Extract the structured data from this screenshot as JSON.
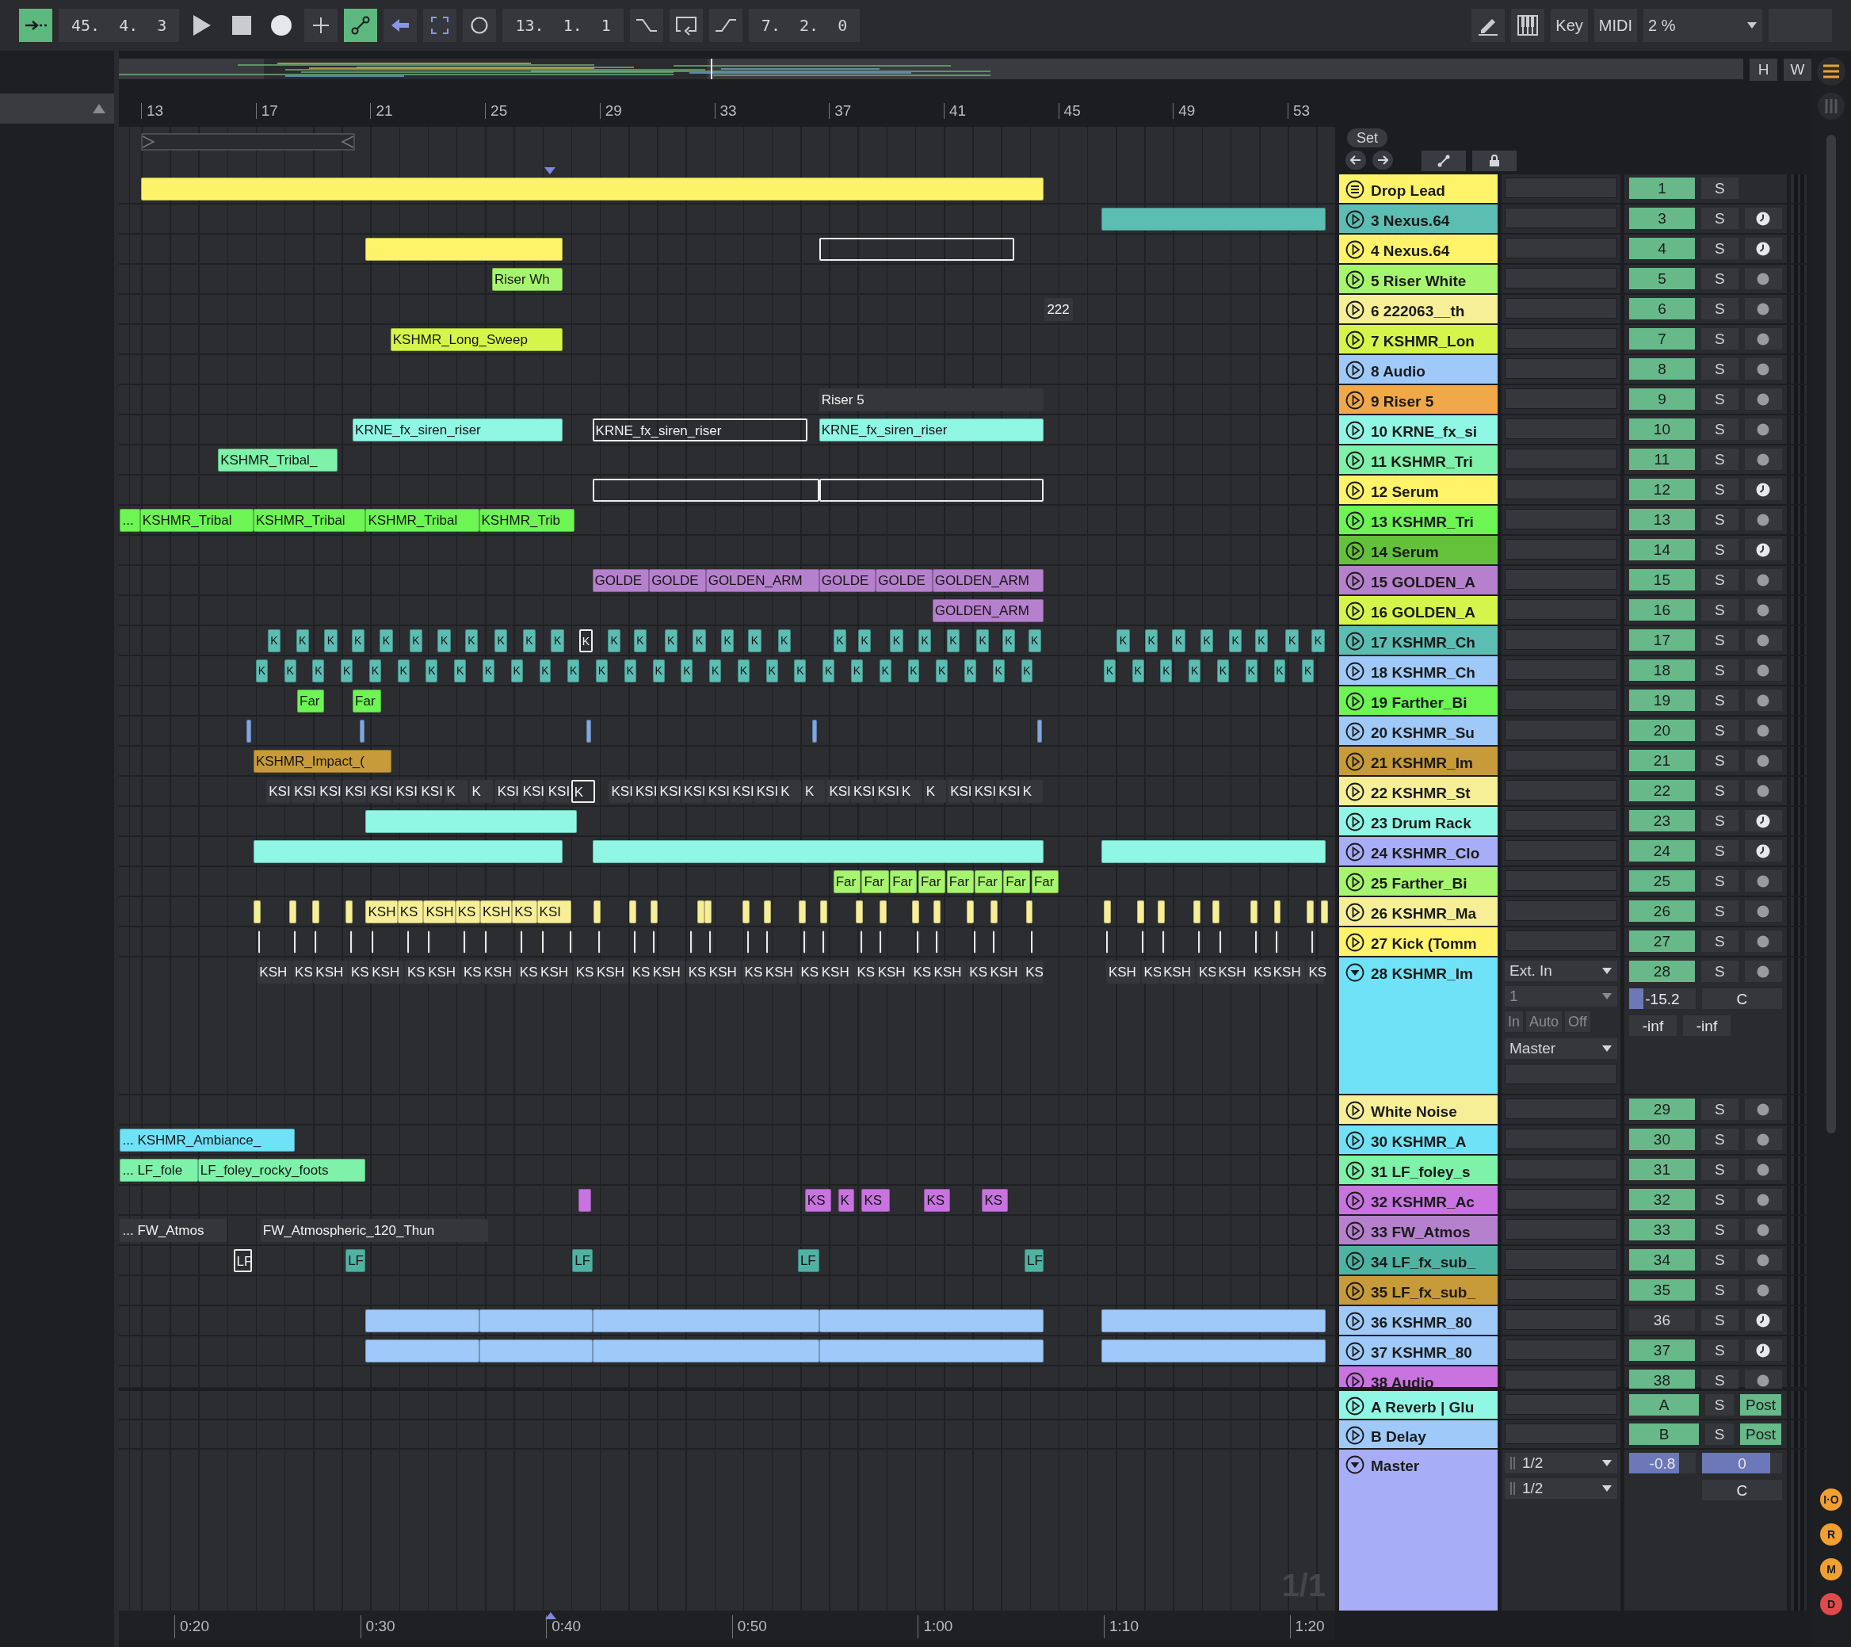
{
  "toolbar": {
    "left": [
      {
        "kind": "follow",
        "on": true
      },
      {
        "kind": "display",
        "text": "45.  4.  3"
      },
      {
        "kind": "play",
        "on": false
      },
      {
        "kind": "stop",
        "on": false
      },
      {
        "kind": "record",
        "on": false
      },
      {
        "kind": "add",
        "on": false
      },
      {
        "kind": "automation",
        "on": true
      },
      {
        "kind": "back",
        "on": false
      },
      {
        "kind": "punch",
        "on": false
      },
      {
        "kind": "loop-record",
        "on": false
      },
      {
        "kind": "display",
        "text": "13.  1.  1"
      },
      {
        "kind": "punch-in",
        "on": false
      },
      {
        "kind": "loop",
        "on": false
      },
      {
        "kind": "punch-out",
        "on": false
      },
      {
        "kind": "display",
        "text": "7.  2.  0"
      }
    ],
    "right": [
      {
        "kind": "draw"
      },
      {
        "kind": "keyboard"
      },
      {
        "kind": "text",
        "text": "Key"
      },
      {
        "kind": "text",
        "text": "MIDI"
      },
      {
        "kind": "cpu",
        "text": "2 %"
      },
      {
        "kind": "blank"
      }
    ]
  },
  "overview": {
    "buttons": [
      "H",
      "W"
    ]
  },
  "ruler": {
    "bars": [
      "13",
      "17",
      "21",
      "25",
      "29",
      "33",
      "37",
      "41",
      "45",
      "49",
      "53"
    ],
    "set_label": "Set"
  },
  "tracks": [
    {
      "kind": "group",
      "name": "Drop Lead",
      "color": "#fff36a",
      "expanded": false,
      "number": "1",
      "number_on": true,
      "solo": "S",
      "clips": [
        {
          "kind": "clip"
        }
      ]
    },
    {
      "kind": "track",
      "name": "3 Nexus.64",
      "color": "#5cbdb3",
      "expanded": false,
      "number": "3",
      "number_on": true,
      "solo": "S",
      "arm": {
        "kind": "clock"
      },
      "clips": [
        {
          "kind": "clip"
        }
      ]
    },
    {
      "kind": "track",
      "name": "4 Nexus.64",
      "color": "#fff36a",
      "expanded": false,
      "number": "4",
      "number_on": true,
      "solo": "S",
      "arm": {
        "kind": "clock"
      },
      "clips": [
        {
          "kind": "clip"
        },
        {
          "kind": "outline"
        }
      ]
    },
    {
      "kind": "track",
      "name": "5 Riser White",
      "color": "#a6f56e",
      "expanded": false,
      "number": "5",
      "number_on": true,
      "solo": "S",
      "arm": {
        "kind": "dot"
      },
      "clips": [
        {
          "kind": "clip",
          "label": "Riser Wh"
        }
      ]
    },
    {
      "kind": "track",
      "name": "6 222063__th",
      "color": "#f6ef98",
      "expanded": false,
      "number": "6",
      "number_on": true,
      "solo": "S",
      "arm": {
        "kind": "dot"
      },
      "clips": [
        {
          "kind": "muted",
          "label": "222"
        }
      ]
    },
    {
      "kind": "track",
      "name": "7 KSHMR_Lon",
      "color": "#d6f54a",
      "expanded": false,
      "number": "7",
      "number_on": true,
      "solo": "S",
      "arm": {
        "kind": "dot"
      },
      "clips": [
        {
          "kind": "clip",
          "label": "KSHMR_Long_Sweep"
        }
      ]
    },
    {
      "kind": "track",
      "name": "8 Audio",
      "color": "#9ec9f8",
      "expanded": false,
      "number": "8",
      "number_on": true,
      "solo": "S",
      "arm": {
        "kind": "dot"
      }
    },
    {
      "kind": "track",
      "name": "9 Riser 5",
      "color": "#f0a848",
      "expanded": false,
      "number": "9",
      "number_on": true,
      "solo": "S",
      "arm": {
        "kind": "dot"
      },
      "clips": [
        {
          "kind": "muted",
          "label": "Riser 5"
        }
      ]
    },
    {
      "kind": "track",
      "name": "10 KRNE_fx_si",
      "color": "#8ff7e4",
      "expanded": false,
      "number": "10",
      "number_on": true,
      "solo": "S",
      "arm": {
        "kind": "dot"
      },
      "clips": [
        {
          "kind": "clip",
          "label": "KRNE_fx_siren_riser"
        },
        {
          "kind": "outline",
          "label": "KRNE_fx_siren_riser"
        },
        {
          "kind": "clip",
          "label": "KRNE_fx_siren_riser"
        }
      ]
    },
    {
      "kind": "track",
      "name": "11 KSHMR_Tri",
      "color": "#7df2a8",
      "expanded": false,
      "number": "11",
      "number_on": true,
      "solo": "S",
      "arm": {
        "kind": "dot"
      },
      "clips": [
        {
          "kind": "clip",
          "label": "KSHMR_Tribal_"
        }
      ]
    },
    {
      "kind": "track",
      "name": "12 Serum",
      "color": "#fff36a",
      "expanded": false,
      "number": "12",
      "number_on": true,
      "solo": "S",
      "arm": {
        "kind": "clock"
      },
      "clips": [
        {
          "kind": "outline"
        },
        {
          "kind": "outline"
        }
      ]
    },
    {
      "kind": "track",
      "name": "13 KSHMR_Tri",
      "color": "#6cf553",
      "expanded": false,
      "number": "13",
      "number_on": true,
      "solo": "S",
      "arm": {
        "kind": "dot"
      },
      "clips": [
        {
          "kind": "clip",
          "label": "..."
        },
        {
          "kind": "clip",
          "label": "KSHMR_Tribal"
        },
        {
          "kind": "clip",
          "label": "KSHMR_Tribal"
        },
        {
          "kind": "clip",
          "label": "KSHMR_Tribal"
        },
        {
          "kind": "clip",
          "label": "KSHMR_Trib"
        }
      ]
    },
    {
      "kind": "track",
      "name": "14 Serum",
      "color": "#63c23a",
      "expanded": false,
      "number": "14",
      "number_on": true,
      "solo": "S",
      "arm": {
        "kind": "clock"
      }
    },
    {
      "kind": "track",
      "name": "15 GOLDEN_A",
      "color": "#b681cc",
      "expanded": false,
      "number": "15",
      "number_on": true,
      "solo": "S",
      "arm": {
        "kind": "dot"
      },
      "clips": [
        {
          "kind": "clip",
          "label": "GOLDE"
        },
        {
          "kind": "clip",
          "label": "GOLDE"
        },
        {
          "kind": "clip",
          "label": "GOLDEN_ARM"
        },
        {
          "kind": "clip",
          "label": "GOLDE"
        },
        {
          "kind": "clip",
          "label": "GOLDE"
        },
        {
          "kind": "clip",
          "label": "GOLDEN_ARM"
        }
      ]
    },
    {
      "kind": "track",
      "name": "16 GOLDEN_A",
      "color": "#d6f54a",
      "expanded": false,
      "number": "16",
      "number_on": true,
      "solo": "S",
      "arm": {
        "kind": "dot"
      },
      "clips": [
        {
          "kind": "clip",
          "label": "GOLDEN_ARM",
          "color": "#b681cc"
        }
      ]
    },
    {
      "kind": "track",
      "name": "17 KSHMR_Ch",
      "color": "#5cbdb3",
      "expanded": false,
      "number": "17",
      "number_on": true,
      "solo": "S",
      "arm": {
        "kind": "dot"
      },
      "clips": [
        {
          "kind": "clip",
          "label": "K"
        },
        {
          "kind": "clip",
          "label": "K"
        },
        {
          "kind": "clip",
          "label": "K"
        },
        {
          "kind": "clip",
          "label": "K"
        },
        {
          "kind": "clip",
          "label": "K"
        },
        {
          "kind": "clip",
          "label": "K"
        },
        {
          "kind": "clip",
          "label": "K"
        },
        {
          "kind": "clip",
          "label": "K"
        },
        {
          "kind": "clip",
          "label": "K"
        },
        {
          "kind": "clip",
          "label": "K"
        },
        {
          "kind": "clip",
          "label": "K"
        },
        {
          "kind": "outline",
          "label": "K"
        },
        {
          "kind": "clip",
          "label": "K"
        },
        {
          "kind": "clip",
          "label": "K"
        },
        {
          "kind": "clip",
          "label": "K"
        },
        {
          "kind": "clip",
          "label": "K"
        },
        {
          "kind": "clip",
          "label": "K"
        },
        {
          "kind": "clip",
          "label": "K"
        },
        {
          "kind": "clip",
          "label": "K"
        },
        {
          "kind": "clip",
          "label": "K"
        },
        {
          "kind": "clip",
          "label": "K"
        },
        {
          "kind": "clip",
          "label": "K"
        },
        {
          "kind": "clip",
          "label": "K"
        },
        {
          "kind": "clip",
          "label": "K"
        },
        {
          "kind": "clip",
          "label": "K"
        },
        {
          "kind": "clip",
          "label": "K"
        },
        {
          "kind": "clip",
          "label": "K"
        },
        {
          "kind": "clip",
          "label": "K"
        },
        {
          "kind": "clip",
          "label": "K"
        },
        {
          "kind": "clip",
          "label": "K"
        },
        {
          "kind": "clip",
          "label": "K"
        },
        {
          "kind": "clip",
          "label": "K"
        },
        {
          "kind": "clip",
          "label": "K"
        },
        {
          "kind": "clip",
          "label": "K"
        },
        {
          "kind": "clip",
          "label": "K"
        }
      ]
    },
    {
      "kind": "track",
      "name": "18 KSHMR_Ch",
      "color": "#9ec9f8",
      "expanded": false,
      "number": "18",
      "number_on": true,
      "solo": "S",
      "arm": {
        "kind": "dot"
      },
      "clips": [
        {
          "kind": "clip",
          "label": "K",
          "color": "#5cbdb3"
        },
        {
          "kind": "clip",
          "label": "K",
          "color": "#5cbdb3"
        },
        {
          "kind": "clip",
          "label": "K",
          "color": "#5cbdb3"
        },
        {
          "kind": "clip",
          "label": "K",
          "color": "#5cbdb3"
        },
        {
          "kind": "clip",
          "label": "K",
          "color": "#5cbdb3"
        },
        {
          "kind": "clip",
          "label": "K",
          "color": "#5cbdb3"
        },
        {
          "kind": "clip",
          "label": "K",
          "color": "#5cbdb3"
        },
        {
          "kind": "clip",
          "label": "K",
          "color": "#5cbdb3"
        },
        {
          "kind": "clip",
          "label": "K",
          "color": "#5cbdb3"
        },
        {
          "kind": "clip",
          "label": "K",
          "color": "#5cbdb3"
        },
        {
          "kind": "clip",
          "label": "K",
          "color": "#5cbdb3"
        },
        {
          "kind": "clip",
          "label": "K",
          "color": "#5cbdb3"
        },
        {
          "kind": "clip",
          "label": "K",
          "color": "#5cbdb3"
        },
        {
          "kind": "clip",
          "label": "K",
          "color": "#5cbdb3"
        },
        {
          "kind": "clip",
          "label": "K",
          "color": "#5cbdb3"
        },
        {
          "kind": "clip",
          "label": "K",
          "color": "#5cbdb3"
        },
        {
          "kind": "clip",
          "label": "K",
          "color": "#5cbdb3"
        },
        {
          "kind": "clip",
          "label": "K",
          "color": "#5cbdb3"
        },
        {
          "kind": "clip",
          "label": "K",
          "color": "#5cbdb3"
        },
        {
          "kind": "clip",
          "label": "K",
          "color": "#5cbdb3"
        },
        {
          "kind": "clip",
          "label": "K",
          "color": "#5cbdb3"
        },
        {
          "kind": "clip",
          "label": "K",
          "color": "#5cbdb3"
        },
        {
          "kind": "clip",
          "label": "K",
          "color": "#5cbdb3"
        },
        {
          "kind": "clip",
          "label": "K",
          "color": "#5cbdb3"
        },
        {
          "kind": "clip",
          "label": "K",
          "color": "#5cbdb3"
        },
        {
          "kind": "clip",
          "label": "K",
          "color": "#5cbdb3"
        },
        {
          "kind": "clip",
          "label": "K",
          "color": "#5cbdb3"
        },
        {
          "kind": "clip",
          "label": "K",
          "color": "#5cbdb3"
        },
        {
          "kind": "clip",
          "label": "K",
          "color": "#5cbdb3"
        },
        {
          "kind": "clip",
          "label": "K",
          "color": "#5cbdb3"
        },
        {
          "kind": "clip",
          "label": "K",
          "color": "#5cbdb3"
        },
        {
          "kind": "clip",
          "label": "K",
          "color": "#5cbdb3"
        },
        {
          "kind": "clip",
          "label": "K",
          "color": "#5cbdb3"
        },
        {
          "kind": "clip",
          "label": "K",
          "color": "#5cbdb3"
        },
        {
          "kind": "clip",
          "label": "K",
          "color": "#5cbdb3"
        },
        {
          "kind": "clip",
          "label": "K",
          "color": "#5cbdb3"
        }
      ]
    },
    {
      "kind": "track",
      "name": "19 Farther_Bi",
      "color": "#6cf553",
      "expanded": false,
      "number": "19",
      "number_on": true,
      "solo": "S",
      "arm": {
        "kind": "dot"
      },
      "clips": [
        {
          "kind": "clip",
          "label": "Far"
        },
        {
          "kind": "clip",
          "label": "Far"
        }
      ]
    },
    {
      "kind": "track",
      "name": "20 KSHMR_Su",
      "color": "#9ec9f8",
      "expanded": false,
      "number": "20",
      "number_on": true,
      "solo": "S",
      "arm": {
        "kind": "dot"
      },
      "clips": [
        {
          "kind": "clip",
          "color": "#7fa7e0"
        },
        {
          "kind": "clip",
          "color": "#7fa7e0"
        },
        {
          "kind": "clip",
          "color": "#7fa7e0"
        },
        {
          "kind": "clip",
          "color": "#7fa7e0"
        },
        {
          "kind": "clip",
          "color": "#7fa7e0"
        }
      ]
    },
    {
      "kind": "track",
      "name": "21 KSHMR_Im",
      "color": "#c79a3a",
      "expanded": false,
      "number": "21",
      "number_on": true,
      "solo": "S",
      "arm": {
        "kind": "dot"
      },
      "clips": [
        {
          "kind": "clip",
          "label": "KSHMR_Impact_("
        }
      ]
    },
    {
      "kind": "track",
      "name": "22 KSHMR_St",
      "color": "#f6ef98",
      "expanded": false,
      "number": "22",
      "number_on": true,
      "solo": "S",
      "arm": {
        "kind": "dot"
      },
      "clips": [
        {
          "kind": "muted",
          "label": "KSI"
        },
        {
          "kind": "muted",
          "label": "KSI"
        },
        {
          "kind": "muted",
          "label": "KSI"
        },
        {
          "kind": "muted",
          "label": "KSI"
        },
        {
          "kind": "muted",
          "label": "KSI"
        },
        {
          "kind": "muted",
          "label": "KSI"
        },
        {
          "kind": "muted",
          "label": "KSI"
        },
        {
          "kind": "muted",
          "label": "K"
        },
        {
          "kind": "muted",
          "label": "K"
        },
        {
          "kind": "muted",
          "label": "KSI"
        },
        {
          "kind": "muted",
          "label": "KSI"
        },
        {
          "kind": "muted",
          "label": "KSI"
        },
        {
          "kind": "outline",
          "label": "K"
        },
        {
          "kind": "muted",
          "label": "KSI"
        },
        {
          "kind": "muted",
          "label": "KSI"
        },
        {
          "kind": "muted",
          "label": "KSI"
        },
        {
          "kind": "muted",
          "label": "KSI"
        },
        {
          "kind": "muted",
          "label": "KSI"
        },
        {
          "kind": "muted",
          "label": "KSI"
        },
        {
          "kind": "muted",
          "label": "KSI"
        },
        {
          "kind": "muted",
          "label": "K"
        },
        {
          "kind": "muted",
          "label": "K"
        },
        {
          "kind": "muted",
          "label": "KSI"
        },
        {
          "kind": "muted",
          "label": "KSI"
        },
        {
          "kind": "muted",
          "label": "KSI"
        },
        {
          "kind": "muted",
          "label": "K"
        },
        {
          "kind": "muted",
          "label": "K"
        },
        {
          "kind": "muted",
          "label": "KSI"
        },
        {
          "kind": "muted",
          "label": "KSI"
        },
        {
          "kind": "muted",
          "label": "KSI"
        },
        {
          "kind": "muted",
          "label": "K"
        }
      ]
    },
    {
      "kind": "track",
      "name": "23 Drum Rack",
      "color": "#8ff7e4",
      "expanded": false,
      "number": "23",
      "number_on": true,
      "solo": "S",
      "arm": {
        "kind": "clock"
      },
      "clips": [
        {
          "kind": "clip"
        }
      ]
    },
    {
      "kind": "track",
      "name": "24 KSHMR_Clo",
      "color": "#a7aef7",
      "expanded": false,
      "number": "24",
      "number_on": true,
      "solo": "S",
      "arm": {
        "kind": "clock"
      },
      "clips": [
        {
          "kind": "clip",
          "color": "#8ff7e4"
        },
        {
          "kind": "clip",
          "color": "#8ff7e4"
        },
        {
          "kind": "clip",
          "color": "#8ff7e4"
        }
      ]
    },
    {
      "kind": "track",
      "name": "25 Farther_Bi",
      "color": "#a6f56e",
      "expanded": false,
      "number": "25",
      "number_on": true,
      "solo": "S",
      "arm": {
        "kind": "dot"
      },
      "clips": [
        {
          "kind": "clip",
          "label": "Far"
        },
        {
          "kind": "clip",
          "label": "Far"
        },
        {
          "kind": "clip",
          "label": "Far"
        },
        {
          "kind": "clip",
          "label": "Far"
        },
        {
          "kind": "clip",
          "label": "Far"
        },
        {
          "kind": "clip",
          "label": "Far"
        },
        {
          "kind": "clip",
          "label": "Far"
        },
        {
          "kind": "clip",
          "label": "Far"
        }
      ]
    },
    {
      "kind": "track",
      "name": "26 KSHMR_Ma",
      "color": "#f6ef98",
      "expanded": false,
      "number": "26",
      "number_on": true,
      "solo": "S",
      "arm": {
        "kind": "dot"
      },
      "clips": [
        {
          "kind": "clip"
        },
        {
          "kind": "clip"
        },
        {
          "kind": "clip"
        },
        {
          "kind": "clip"
        },
        {
          "kind": "clip",
          "label": "KSH"
        },
        {
          "kind": "clip",
          "label": "KS"
        },
        {
          "kind": "clip",
          "label": "KSH"
        },
        {
          "kind": "clip",
          "label": "KS"
        },
        {
          "kind": "clip",
          "label": "KSH"
        },
        {
          "kind": "clip",
          "label": "KS"
        },
        {
          "kind": "clip",
          "label": "KSI"
        },
        {
          "kind": "clip"
        },
        {
          "kind": "clip"
        },
        {
          "kind": "clip"
        },
        {
          "kind": "clip"
        },
        {
          "kind": "clip"
        },
        {
          "kind": "clip"
        },
        {
          "kind": "clip"
        },
        {
          "kind": "clip"
        },
        {
          "kind": "clip"
        },
        {
          "kind": "clip"
        },
        {
          "kind": "clip"
        },
        {
          "kind": "clip"
        },
        {
          "kind": "clip"
        },
        {
          "kind": "clip"
        },
        {
          "kind": "clip"
        },
        {
          "kind": "clip"
        },
        {
          "kind": "clip"
        },
        {
          "kind": "clip"
        },
        {
          "kind": "clip"
        },
        {
          "kind": "clip"
        },
        {
          "kind": "clip"
        },
        {
          "kind": "clip"
        },
        {
          "kind": "clip"
        },
        {
          "kind": "clip"
        },
        {
          "kind": "clip"
        }
      ]
    },
    {
      "kind": "track",
      "name": "27 Kick (Tomm",
      "color": "#fff36a",
      "expanded": false,
      "number": "27",
      "number_on": true,
      "solo": "S",
      "arm": {
        "kind": "dot"
      },
      "clips": [
        {
          "kind": "tick"
        },
        {
          "kind": "tick"
        },
        {
          "kind": "tick"
        },
        {
          "kind": "tick"
        },
        {
          "kind": "tick"
        },
        {
          "kind": "tick"
        },
        {
          "kind": "tick"
        },
        {
          "kind": "tick"
        },
        {
          "kind": "tick"
        },
        {
          "kind": "tick"
        },
        {
          "kind": "tick"
        },
        {
          "kind": "tick"
        },
        {
          "kind": "tick"
        },
        {
          "kind": "tick"
        },
        {
          "kind": "tick"
        },
        {
          "kind": "tick"
        },
        {
          "kind": "tick"
        },
        {
          "kind": "tick"
        },
        {
          "kind": "tick"
        },
        {
          "kind": "tick"
        },
        {
          "kind": "tick"
        },
        {
          "kind": "tick"
        },
        {
          "kind": "tick"
        },
        {
          "kind": "tick"
        },
        {
          "kind": "tick"
        },
        {
          "kind": "tick"
        },
        {
          "kind": "tick"
        },
        {
          "kind": "tick"
        },
        {
          "kind": "tick"
        },
        {
          "kind": "tick"
        },
        {
          "kind": "tick"
        },
        {
          "kind": "tick"
        },
        {
          "kind": "tick"
        },
        {
          "kind": "tick"
        },
        {
          "kind": "tick"
        },
        {
          "kind": "tick"
        }
      ]
    },
    {
      "kind": "track",
      "name": "28 KSHMR_Im",
      "color": "#6fe2f7",
      "expanded": true,
      "number": "28",
      "number_on": true,
      "solo": "S",
      "arm": {
        "kind": "dot"
      },
      "io": {
        "input": "Ext. In",
        "channel": "1",
        "monitor": [
          {
            "label": "In",
            "selected": false
          },
          {
            "label": "Auto",
            "selected": false
          },
          {
            "label": "Off",
            "selected": false
          }
        ],
        "output": "Master"
      },
      "volume": {
        "text": "-15.2",
        "level": 0.22
      },
      "pan": "C",
      "peaks": [
        "-inf",
        "-inf"
      ],
      "clips": [
        {
          "kind": "muted",
          "label": "KSH"
        },
        {
          "kind": "muted",
          "label": "KS"
        },
        {
          "kind": "muted",
          "label": "KSH"
        },
        {
          "kind": "muted",
          "label": "KS"
        },
        {
          "kind": "muted",
          "label": "KSH"
        },
        {
          "kind": "muted",
          "label": "KS"
        },
        {
          "kind": "muted",
          "label": "KSH"
        },
        {
          "kind": "muted",
          "label": "KS"
        },
        {
          "kind": "muted",
          "label": "KSH"
        },
        {
          "kind": "muted",
          "label": "KS"
        },
        {
          "kind": "muted",
          "label": "KSH"
        },
        {
          "kind": "muted",
          "label": "KS"
        },
        {
          "kind": "muted",
          "label": "KSH"
        },
        {
          "kind": "muted",
          "label": "KS"
        },
        {
          "kind": "muted",
          "label": "KSH"
        },
        {
          "kind": "muted",
          "label": "KS"
        },
        {
          "kind": "muted",
          "label": "KSH"
        },
        {
          "kind": "muted",
          "label": "KS"
        },
        {
          "kind": "muted",
          "label": "KSH"
        },
        {
          "kind": "muted",
          "label": "KS"
        },
        {
          "kind": "muted",
          "label": "KSH"
        },
        {
          "kind": "muted",
          "label": "KS"
        },
        {
          "kind": "muted",
          "label": "KSH"
        },
        {
          "kind": "muted",
          "label": "KS"
        },
        {
          "kind": "muted",
          "label": "KSH"
        },
        {
          "kind": "muted",
          "label": "KS"
        },
        {
          "kind": "muted",
          "label": "KSH"
        },
        {
          "kind": "muted",
          "label": "KS"
        },
        {
          "kind": "muted",
          "label": "KSH"
        },
        {
          "kind": "muted",
          "label": "KS"
        },
        {
          "kind": "muted",
          "label": "KSH"
        },
        {
          "kind": "muted",
          "label": "KS"
        },
        {
          "kind": "muted",
          "label": "KSH"
        },
        {
          "kind": "muted",
          "label": "KS"
        },
        {
          "kind": "muted",
          "label": "KSH"
        },
        {
          "kind": "muted",
          "label": "KS"
        }
      ]
    },
    {
      "kind": "track",
      "name": "White Noise",
      "color": "#f6ef98",
      "expanded": false,
      "number": "29",
      "number_on": true,
      "solo": "S",
      "arm": {
        "kind": "dot"
      }
    },
    {
      "kind": "track",
      "name": "30 KSHMR_A",
      "color": "#6fe2f7",
      "expanded": false,
      "number": "30",
      "number_on": true,
      "solo": "S",
      "arm": {
        "kind": "dot"
      },
      "clips": [
        {
          "kind": "clip",
          "label": "... KSHMR_Ambiance_"
        }
      ]
    },
    {
      "kind": "track",
      "name": "31 LF_foley_s",
      "color": "#7df2a8",
      "expanded": false,
      "number": "31",
      "number_on": true,
      "solo": "S",
      "arm": {
        "kind": "dot"
      },
      "clips": [
        {
          "kind": "clip",
          "label": "... LF_fole"
        },
        {
          "kind": "clip",
          "label": "LF_foley_rocky_foots"
        }
      ]
    },
    {
      "kind": "track",
      "name": "32 KSHMR_Ac",
      "color": "#c873e0",
      "expanded": false,
      "number": "32",
      "number_on": true,
      "solo": "S",
      "arm": {
        "kind": "dot"
      },
      "clips": [
        {
          "kind": "clip"
        },
        {
          "kind": "clip",
          "label": "KS"
        },
        {
          "kind": "clip",
          "label": "K"
        },
        {
          "kind": "clip",
          "label": "KS"
        },
        {
          "kind": "clip",
          "label": "KS"
        },
        {
          "kind": "clip",
          "label": "KS"
        }
      ]
    },
    {
      "kind": "track",
      "name": "33 FW_Atmos",
      "color": "#b681cc",
      "expanded": false,
      "number": "33",
      "number_on": true,
      "solo": "S",
      "arm": {
        "kind": "dot"
      },
      "clips": [
        {
          "kind": "muted",
          "label": "... FW_Atmos"
        },
        {
          "kind": "muted",
          "label": "FW_Atmospheric_120_Thun"
        }
      ]
    },
    {
      "kind": "track",
      "name": "34 LF_fx_sub_",
      "color": "#4fb3a2",
      "expanded": false,
      "number": "34",
      "number_on": true,
      "solo": "S",
      "arm": {
        "kind": "dot"
      },
      "clips": [
        {
          "kind": "outline",
          "label": "LF"
        },
        {
          "kind": "clip",
          "label": "LF"
        },
        {
          "kind": "clip",
          "label": "LF"
        },
        {
          "kind": "clip",
          "label": "LF"
        },
        {
          "kind": "clip",
          "label": "LF"
        }
      ]
    },
    {
      "kind": "track",
      "name": "35 LF_fx_sub_",
      "color": "#c79a3a",
      "expanded": false,
      "number": "35",
      "number_on": true,
      "solo": "S",
      "arm": {
        "kind": "dot"
      }
    },
    {
      "kind": "track",
      "name": "36 KSHMR_80",
      "color": "#9ec9f8",
      "expanded": false,
      "number": "36",
      "number_on": false,
      "solo": "S",
      "arm": {
        "kind": "clock"
      },
      "clips": [
        {
          "kind": "clip"
        },
        {
          "kind": "clip"
        },
        {
          "kind": "clip"
        },
        {
          "kind": "clip"
        },
        {
          "kind": "clip"
        }
      ]
    },
    {
      "kind": "track",
      "name": "37 KSHMR_80",
      "color": "#9ec9f8",
      "expanded": false,
      "number": "37",
      "number_on": true,
      "solo": "S",
      "arm": {
        "kind": "clock"
      },
      "clips": [
        {
          "kind": "clip"
        },
        {
          "kind": "clip"
        },
        {
          "kind": "clip"
        },
        {
          "kind": "clip"
        },
        {
          "kind": "clip"
        }
      ]
    },
    {
      "kind": "track",
      "name": "38 Audio",
      "color": "#c873e0",
      "expanded": false,
      "number": "38",
      "number_on": true,
      "solo": "S",
      "arm": {
        "kind": "dot"
      }
    }
  ],
  "returns": [
    {
      "name": "A Reverb | Glu",
      "color": "#8ff7e4",
      "letter": "A",
      "solo": "S",
      "send": "Post"
    },
    {
      "name": "B Delay",
      "color": "#9ec9f8",
      "letter": "B",
      "solo": "S",
      "send": "Post"
    }
  ],
  "master": {
    "name": "Master",
    "color": "#a7aef7",
    "expanded": true,
    "outputs": [
      "1/2",
      "1/2"
    ],
    "volume": {
      "text": "-0.8",
      "level": 0.75
    },
    "cue": {
      "text": "0",
      "level": 0.85
    },
    "pan": "C"
  },
  "grid_label": "1/1",
  "time_ruler": [
    "0:20",
    "0:30",
    "0:40",
    "0:50",
    "1:00",
    "1:10",
    "1:20"
  ],
  "side_buttons": [
    {
      "text": "I·O",
      "color": "#f0a030"
    },
    {
      "text": "R",
      "color": "#f0a030"
    },
    {
      "text": "M",
      "color": "#f0a030"
    },
    {
      "text": "D",
      "color": "#e04a4a"
    }
  ]
}
